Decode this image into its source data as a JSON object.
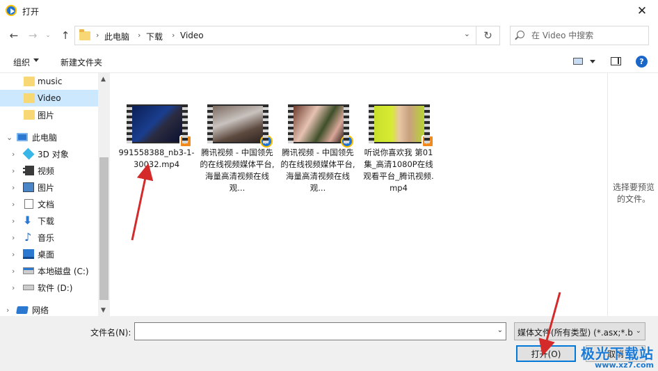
{
  "window": {
    "title": "打开",
    "close_glyph": "✕"
  },
  "nav": {
    "back_glyph": "←",
    "forward_glyph": "→",
    "recent_glyph": "⌄",
    "up_glyph": "↑",
    "breadcrumb": [
      "此电脑",
      "下载",
      "Video"
    ],
    "separator": "›",
    "dropdown_glyph": "⌄",
    "refresh_glyph": "↻",
    "search_placeholder": "在 Video 中搜索"
  },
  "toolbar": {
    "organize": "组织",
    "new_folder": "新建文件夹",
    "help": "?"
  },
  "sidebar": {
    "items": [
      {
        "label": "music",
        "icon": "folder-icon",
        "expander": ""
      },
      {
        "label": "Video",
        "icon": "folder-icon",
        "expander": "",
        "selected": true
      },
      {
        "label": "图片",
        "icon": "folder-icon",
        "expander": ""
      },
      {
        "label": "此电脑",
        "icon": "computer-icon",
        "expander": "⌄"
      },
      {
        "label": "3D 对象",
        "icon": "cube-icon",
        "expander": "›"
      },
      {
        "label": "视频",
        "icon": "video-folder-icon",
        "expander": "›"
      },
      {
        "label": "图片",
        "icon": "pictures-icon",
        "expander": "›"
      },
      {
        "label": "文档",
        "icon": "document-icon",
        "expander": "›"
      },
      {
        "label": "下载",
        "icon": "download-icon",
        "expander": "›"
      },
      {
        "label": "音乐",
        "icon": "music-icon",
        "expander": "›"
      },
      {
        "label": "桌面",
        "icon": "desktop-icon",
        "expander": "›"
      },
      {
        "label": "本地磁盘 (C:)",
        "icon": "drive-c-icon",
        "expander": "›"
      },
      {
        "label": "软件 (D:)",
        "icon": "drive-d-icon",
        "expander": "›"
      },
      {
        "label": "网络",
        "icon": "network-icon",
        "expander": "›"
      }
    ],
    "scroll_up_glyph": "▲",
    "scroll_down_glyph": "▼"
  },
  "files": [
    {
      "name": "991558388_nb3-1-30032.mp4",
      "badge": "orange"
    },
    {
      "name": "腾讯视频 - 中国领先的在线视频媒体平台,海量高清视频在线观...",
      "badge": "blue"
    },
    {
      "name": "腾讯视频 - 中国领先的在线视频媒体平台,海量高清视频在线观...",
      "badge": "blue"
    },
    {
      "name": "听说你喜欢我 第01集_高清1080P在线观看平台_腾讯视频.mp4",
      "badge": "orange"
    }
  ],
  "preview": {
    "text": "选择要预览的文件。"
  },
  "bottom": {
    "filename_label": "文件名(N):",
    "filename_value": "",
    "dropdown_glyph": "⌄",
    "filetype": "媒体文件(所有类型) (*.asx;*.bil",
    "open_button": "打开(O)",
    "cancel_button": "取消"
  },
  "watermark": {
    "main": "极光下载站",
    "url": "www.xz7.com"
  },
  "colors": {
    "selection": "#cce8ff",
    "accent": "#0078d7",
    "arrow": "#d42a2a"
  }
}
